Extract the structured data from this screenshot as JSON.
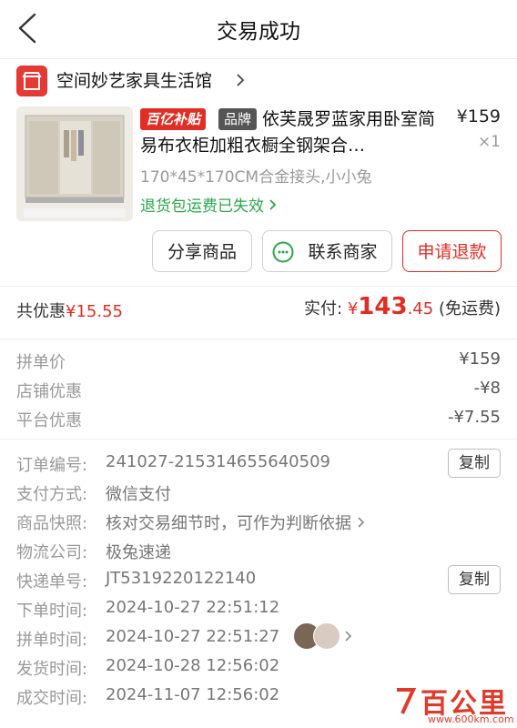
{
  "header": {
    "title": "交易成功"
  },
  "store": {
    "name": "空间妙艺家具生活馆"
  },
  "product": {
    "tag_subsidy": "百亿补贴",
    "tag_brand": "品牌",
    "title": "依芙晟罗蓝家用卧室简易布衣柜加粗衣橱全钢架合…",
    "price": "¥159",
    "quantity": "×1",
    "spec": "170*45*170CM合金接头,小小兔",
    "refund_note": "退货包运费已失效"
  },
  "actions": {
    "share": "分享商品",
    "contact": "联系商家",
    "refund": "申请退款"
  },
  "summary": {
    "discount_label": "共优惠",
    "discount_value": "¥15.55",
    "paid_label": "实付:",
    "paid_currency": "¥",
    "paid_int": "143",
    "paid_dec": ".45",
    "paid_note": "(免运费)"
  },
  "prices": [
    {
      "label": "拼单价",
      "value": "¥159"
    },
    {
      "label": "店铺优惠",
      "value": "-¥8"
    },
    {
      "label": "平台优惠",
      "value": "-¥7.55"
    }
  ],
  "order": [
    {
      "label": "订单编号:",
      "value": "241027-215314655640509"
    },
    {
      "label": "支付方式:",
      "value": "微信支付"
    },
    {
      "label": "商品快照:",
      "value": "核对交易细节时，可作为判断依据"
    },
    {
      "label": "物流公司:",
      "value": "极兔速递"
    },
    {
      "label": "快递单号:",
      "value": "JT5319220122140"
    },
    {
      "label": "下单时间:",
      "value": "2024-10-27 22:51:12"
    },
    {
      "label": "拼单时间:",
      "value": "2024-10-27 22:51:27"
    },
    {
      "label": "发货时间:",
      "value": "2024-10-28 12:56:02"
    },
    {
      "label": "成交时间:",
      "value": "2024-11-07 12:56:02"
    }
  ],
  "copy_label": "复制",
  "watermark": {
    "text": "百公里",
    "url": "www.600km.com"
  },
  "colors": {
    "accent": "#e02e24",
    "green": "#2aa84a"
  }
}
